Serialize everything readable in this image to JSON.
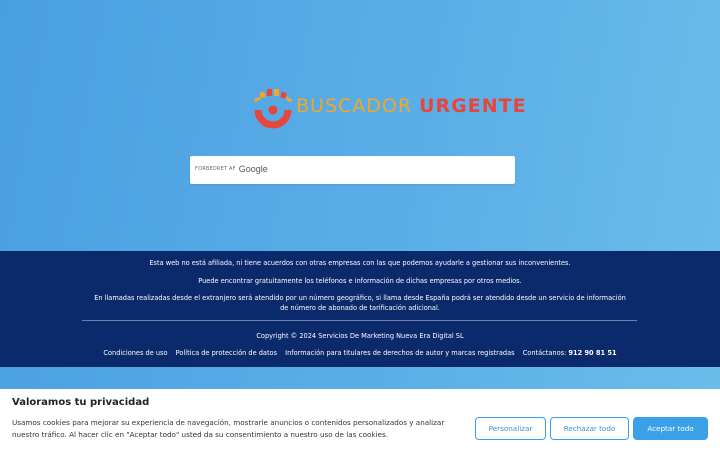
{
  "logo": {
    "word1": "BUSCADOR",
    "word2": "URGENTE"
  },
  "search": {
    "branding_prefix": "FORBEDRET AF",
    "branding_google": "Google"
  },
  "footer": {
    "line1": "Esta web no está afiliada, ni tiene acuerdos con otras empresas con las que podemos ayudarle a gestionar sus inconvenientes.",
    "line2": "Puede encontrar gratuitamente los teléfonos e información de dichas empresas por otros medios.",
    "line3": "En llamadas realizadas desde el extranjero será atendido por un número geográfico, si llama desde España podrá ser atendido desde un servicio de información de número de abonado de tarificación adicional.",
    "copyright": "Copyright © 2024 Servicios De Marketing Nueva Era Digital SL",
    "links": [
      "Condiciones de uso",
      "Política de protección de datos",
      "Información para titulares de derechos de autor y marcas registradas"
    ],
    "contact_label": "Contáctanos:",
    "phone": "912 90 81 51"
  },
  "cookie": {
    "title": "Valoramos tu privacidad",
    "text": "Usamos cookies para mejorar su experiencia de navegación, mostrarle anuncios o contenidos personalizados y analizar nuestro tráfico. Al hacer clic en \"Aceptar todo\" usted da su consentimiento a nuestro uso de las cookies.",
    "btn_customize": "Personalizar",
    "btn_reject": "Rechazar todo",
    "btn_accept": "Aceptar todo"
  },
  "colors": {
    "footer_bg": "#0a2a6b",
    "accent": "#3aa0e8",
    "logo_orange": "#f5a623",
    "logo_red": "#e8463a"
  }
}
